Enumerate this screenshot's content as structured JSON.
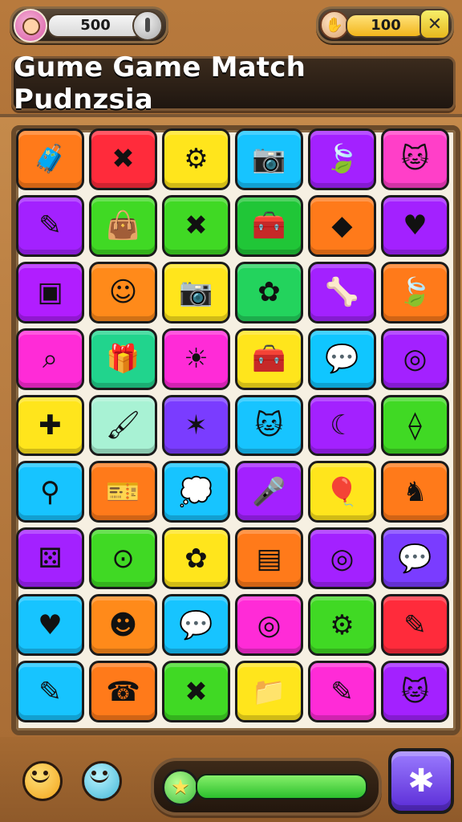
{
  "hud": {
    "left_score": "500",
    "right_score": "100"
  },
  "title": "Gume Game Match Pudnzsia",
  "icons": {
    "avatar": "avatar-icon",
    "pause": "pause-icon",
    "hand": "hand-icon",
    "close": "close-icon",
    "star": "star-icon",
    "settings": "settings-icon"
  },
  "progress": {
    "fill": 1.0
  },
  "board": {
    "rows": 9,
    "cols": 6,
    "tiles": [
      {
        "icon": "suitcase-icon",
        "glyph": "🧳",
        "color": "#ff7a1a"
      },
      {
        "icon": "crossed-tools-icon",
        "glyph": "✖",
        "color": "#ff2b3b"
      },
      {
        "icon": "gear-icon",
        "glyph": "⚙",
        "color": "#ffe51c"
      },
      {
        "icon": "camera-icon",
        "glyph": "📷",
        "color": "#17c4ff"
      },
      {
        "icon": "leaf-icon",
        "glyph": "🍃",
        "color": "#a321ff"
      },
      {
        "icon": "cat-face-icon",
        "glyph": "🐱",
        "color": "#ff3fc8"
      },
      {
        "icon": "pencil-icon",
        "glyph": "✎",
        "color": "#a321ff"
      },
      {
        "icon": "camera-bag-icon",
        "glyph": "👜",
        "color": "#40d924"
      },
      {
        "icon": "crossed-tools-icon",
        "glyph": "✖",
        "color": "#40d924"
      },
      {
        "icon": "medical-kit-icon",
        "glyph": "🧰",
        "color": "#20c637"
      },
      {
        "icon": "gem-icon",
        "glyph": "◆",
        "color": "#ff7a1a"
      },
      {
        "icon": "heart-icon",
        "glyph": "♥",
        "color": "#a321ff"
      },
      {
        "icon": "photo-icon",
        "glyph": "▣",
        "color": "#b11dff"
      },
      {
        "icon": "smile-icon",
        "glyph": "☺",
        "color": "#ff8a1a"
      },
      {
        "icon": "camera-icon",
        "glyph": "📷",
        "color": "#ffe51c"
      },
      {
        "icon": "ghost-icon",
        "glyph": "✿",
        "color": "#23d35d"
      },
      {
        "icon": "bone-icon",
        "glyph": "🦴",
        "color": "#a321ff"
      },
      {
        "icon": "leaf-icon",
        "glyph": "🍃",
        "color": "#ff7a1a"
      },
      {
        "icon": "magnifier-icon",
        "glyph": "⌕",
        "color": "#ff2bd7"
      },
      {
        "icon": "gift-icon",
        "glyph": "🎁",
        "color": "#21d48d"
      },
      {
        "icon": "sun-icon",
        "glyph": "☀",
        "color": "#ff2bd7"
      },
      {
        "icon": "medical-kit-icon",
        "glyph": "🧰",
        "color": "#ffe51c"
      },
      {
        "icon": "chat-icon",
        "glyph": "💬",
        "color": "#10c6ff"
      },
      {
        "icon": "ring-icon",
        "glyph": "◎",
        "color": "#a321ff"
      },
      {
        "icon": "chat-plus-icon",
        "glyph": "✚",
        "color": "#ffe51c"
      },
      {
        "icon": "paintbrush-icon",
        "glyph": "🖌",
        "color": "#a8f2d4"
      },
      {
        "icon": "badge-icon",
        "glyph": "✶",
        "color": "#7a3cff"
      },
      {
        "icon": "cat-face-icon",
        "glyph": "🐱",
        "color": "#17c4ff"
      },
      {
        "icon": "moon-icon",
        "glyph": "☾",
        "color": "#a321ff"
      },
      {
        "icon": "dropper-icon",
        "glyph": "⟠",
        "color": "#40d924"
      },
      {
        "icon": "tools-icon",
        "glyph": "⚲",
        "color": "#17c4ff"
      },
      {
        "icon": "ticket-icon",
        "glyph": "🎫",
        "color": "#ff7a1a"
      },
      {
        "icon": "bubble-icon",
        "glyph": "💭",
        "color": "#17c4ff"
      },
      {
        "icon": "microphone-icon",
        "glyph": "🎤",
        "color": "#a321ff"
      },
      {
        "icon": "balloon-icon",
        "glyph": "🎈",
        "color": "#ffe51c"
      },
      {
        "icon": "knight-icon",
        "glyph": "♞",
        "color": "#ff7a1a"
      },
      {
        "icon": "dice-icon",
        "glyph": "⚄",
        "color": "#a321ff"
      },
      {
        "icon": "target-icon",
        "glyph": "⊙",
        "color": "#40d924"
      },
      {
        "icon": "flower-icon",
        "glyph": "✿",
        "color": "#ffe51c"
      },
      {
        "icon": "scroll-icon",
        "glyph": "▤",
        "color": "#ff7a1a"
      },
      {
        "icon": "ring-icon",
        "glyph": "◎",
        "color": "#a321ff"
      },
      {
        "icon": "chat-icon",
        "glyph": "💬",
        "color": "#7a3cff"
      },
      {
        "icon": "heart-icon",
        "glyph": "♥",
        "color": "#17c4ff"
      },
      {
        "icon": "lion-face-icon",
        "glyph": "☻",
        "color": "#ff8a1a"
      },
      {
        "icon": "chat-icon",
        "glyph": "💬",
        "color": "#17c4ff"
      },
      {
        "icon": "ring-icon",
        "glyph": "◎",
        "color": "#ff2bd7"
      },
      {
        "icon": "gear-icon",
        "glyph": "⚙",
        "color": "#40d924"
      },
      {
        "icon": "pencil-icon",
        "glyph": "✎",
        "color": "#ff2b3b"
      },
      {
        "icon": "pencil-icon",
        "glyph": "✎",
        "color": "#17c4ff"
      },
      {
        "icon": "phone-icon",
        "glyph": "☎",
        "color": "#ff7a1a"
      },
      {
        "icon": "crossed-tools-icon",
        "glyph": "✖",
        "color": "#40d924"
      },
      {
        "icon": "folder-icon",
        "glyph": "📁",
        "color": "#ffe51c"
      },
      {
        "icon": "pencil-icon",
        "glyph": "✎",
        "color": "#ff2bd7"
      },
      {
        "icon": "cat-face-icon",
        "glyph": "🐱",
        "color": "#a321ff"
      }
    ]
  }
}
